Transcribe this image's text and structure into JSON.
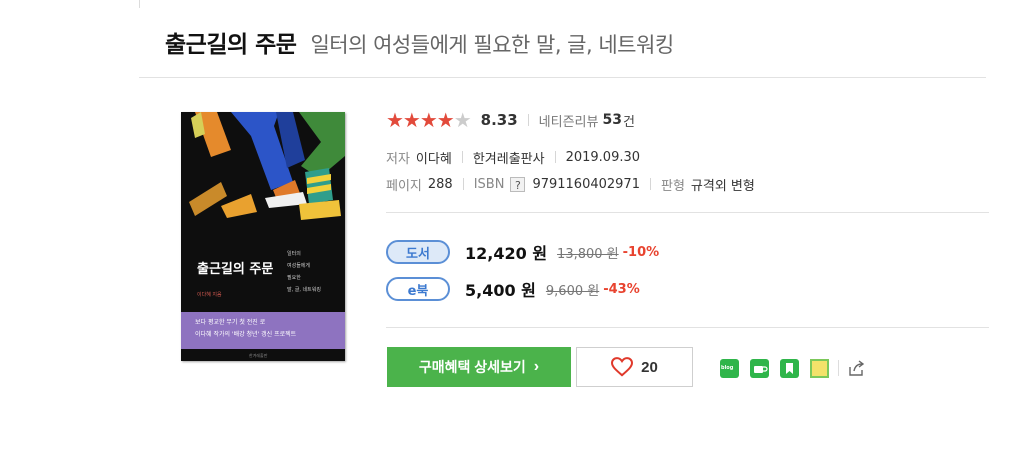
{
  "book": {
    "title": "출근길의 주문",
    "subtitle": "일터의 여성들에게 필요한 말, 글, 네트워킹"
  },
  "cover": {
    "title": "출근길의 주문",
    "subtitle_lines": "일터의\n여성들에게\n필요한\n말, 글, 네트워킹",
    "author_line": "이다혜 지음",
    "band_text": "보다 평교한 무기 첫 전진 로\n이다혜 작가의 '배강 청년' 갱신 프로젝트",
    "publisher_mark": "한겨레출판",
    "band_color": "#8e73c0"
  },
  "rating": {
    "stars_on": "★★★★",
    "stars_off": "★",
    "value": "8.33",
    "review_label": "네티즌리뷰",
    "review_count": "53",
    "review_unit": "건"
  },
  "meta": {
    "author_label": "저자",
    "author": "이다혜",
    "publisher": "한겨레출판사",
    "date": "2019.09.30",
    "pages_label": "페이지",
    "pages": "288",
    "isbn_label": "ISBN",
    "isbn_help": "?",
    "isbn": "9791160402971",
    "format_label": "판형",
    "format": "규격외 변형"
  },
  "prices": {
    "book": {
      "badge": "도서",
      "price": "12,420 원",
      "original": "13,800 원",
      "discount": "-10%"
    },
    "ebook": {
      "badge": "e북",
      "price": "5,400 원",
      "original": "9,600 원",
      "discount": "-43%"
    }
  },
  "actions": {
    "buy_label": "구매혜택 상세보기",
    "buy_arrow": "›",
    "like_count": "20"
  },
  "share": {
    "icons": [
      "blog-share-icon",
      "cafe-share-icon",
      "bookmark-share-icon",
      "memo-share-icon",
      "share-export-icon"
    ],
    "blog_text": "blog"
  },
  "colors": {
    "star": "#e24a3b",
    "discount": "#e8432f",
    "buy_button": "#4bb34b",
    "badge_border": "#5b8fd6"
  }
}
